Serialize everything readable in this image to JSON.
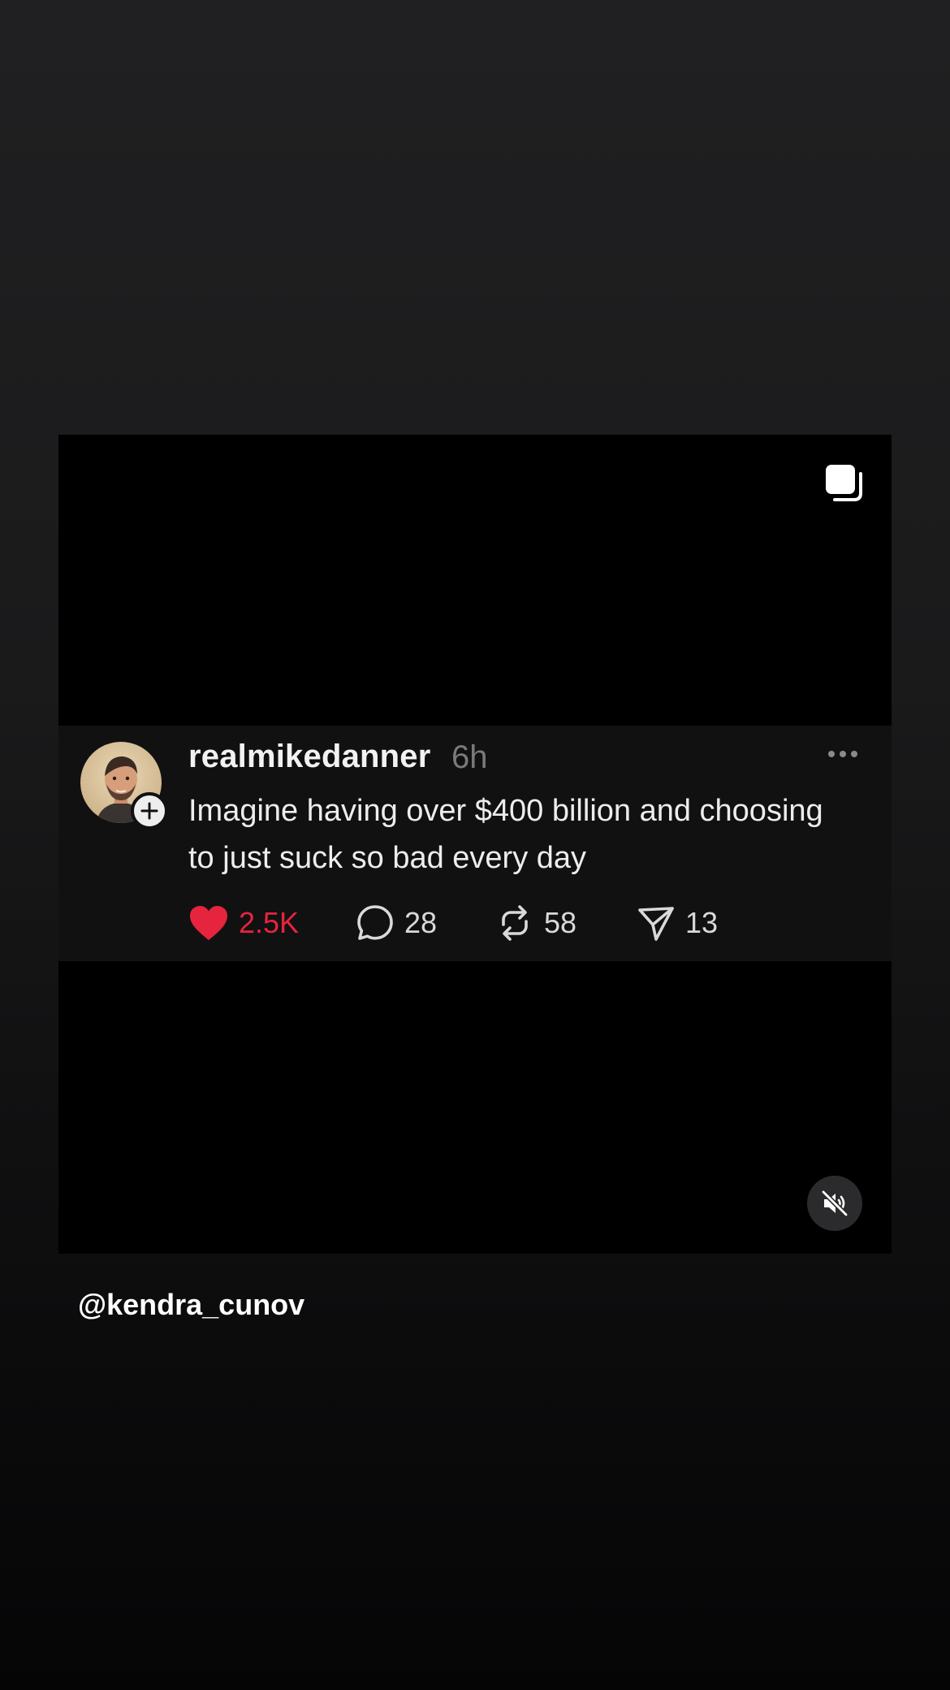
{
  "post": {
    "username": "realmikedanner",
    "time": "6h",
    "text": "Imagine having over $400 billion and choosing to just suck so bad every day",
    "likes": "2.5K",
    "comments": "28",
    "reposts": "58",
    "shares": "13",
    "liked": true
  },
  "story": {
    "mention": "@kendra_cunov",
    "muted": true
  },
  "icons": {
    "multi_post": "stack-icon",
    "follow": "plus-icon",
    "more": "more-dots-icon",
    "like": "heart-icon",
    "comment": "comment-icon",
    "repost": "repost-icon",
    "share": "send-icon",
    "mute": "speaker-muted-icon"
  },
  "colors": {
    "like_red": "#e6243d",
    "card_bg": "#000000",
    "post_bg": "#111112",
    "timestamp_gray": "#7a7a7a"
  }
}
